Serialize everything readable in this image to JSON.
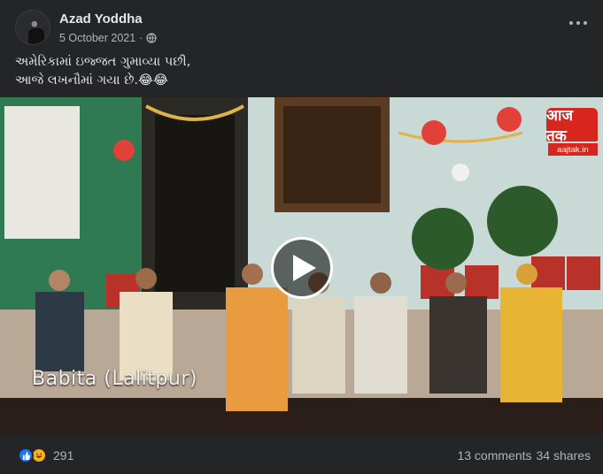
{
  "post": {
    "author": "Azad Yoddha",
    "date": "5 October 2021",
    "separator": "·",
    "privacy_icon": "globe-icon",
    "text_lines": [
      "અમેરિકામાં ઇજ્જત ગુમાવ્યા પછી,",
      "આજે લખનૌમાં ગયા છે.😂😂"
    ]
  },
  "video": {
    "caption": "Babita (Lalitpur)",
    "logo_text": "आज तक",
    "logo_url": "aajtak.in",
    "play_icon": "play-icon"
  },
  "footer": {
    "reaction_count": "291",
    "comments": "13 comments",
    "shares": "34 shares"
  },
  "colors": {
    "background": "#242526",
    "text_primary": "#e4e6eb",
    "text_secondary": "#b0b3b8",
    "like_blue": "#1877f2",
    "haha_yellow": "#f7b125",
    "logo_red": "#d7261e"
  }
}
